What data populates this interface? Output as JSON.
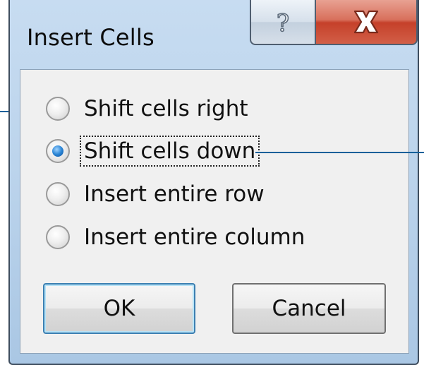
{
  "window": {
    "title": "Insert Cells",
    "help_glyph": "?",
    "close_glyph": "X"
  },
  "options": [
    {
      "label": "Shift cells right",
      "checked": false
    },
    {
      "label": "Shift cells down",
      "checked": true
    },
    {
      "label": "Insert entire row",
      "checked": false
    },
    {
      "label": "Insert entire column",
      "checked": false
    }
  ],
  "buttons": {
    "ok": "OK",
    "cancel": "Cancel"
  },
  "colors": {
    "title_bar": "#bcd4ec",
    "close_button": "#c5402a",
    "radio_selected": "#2c86d6",
    "callout_line": "#15609a"
  }
}
